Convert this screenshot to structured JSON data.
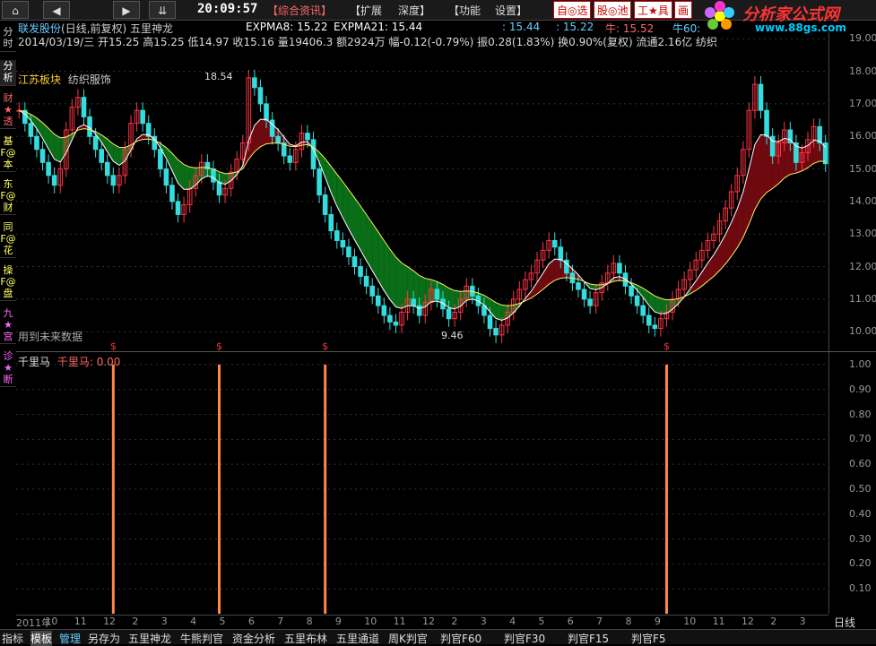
{
  "toolbar": {
    "nav_buttons": [
      "⌂",
      "◀",
      "▶",
      "⇊"
    ],
    "time": "20:09:57",
    "menus": [
      "【综合资讯】",
      "【扩展",
      "深度】",
      "【功能",
      "设置】"
    ],
    "right_buttons": [
      "自◎选",
      "股◎池",
      "工★具",
      "画"
    ],
    "logo": "分析家公式网",
    "logo_url": "www.88gs.com"
  },
  "left_tabs": [
    "分时",
    "分析",
    "财★透",
    "基F@本",
    "东F@财",
    "同F@花",
    "操F@盘",
    "九★宫",
    "诊★断"
  ],
  "header": {
    "stock": "联发股份",
    "mode": "(日线,前复权)",
    "indicator": "五里神龙",
    "expma8": "EXPMA8: 15.22",
    "expma21": "EXPMA21: 15.44",
    "r1": ": 15.44",
    "r2": ": 15.22",
    "r3": "牛: 15.52",
    "r4": "牛60:",
    "line2": "2014/03/19/三 开15.25 高15.25 低14.97 收15.16 量19406.3 额2924万 幅-0.12(-0.79%) 振0.28(1.83%) 换0.90%(复权) 流通2.16亿 纺织",
    "sector": "江苏板块",
    "industry": "纺织服饰",
    "hint": "用到未来数据",
    "hi_label": "18.54",
    "lo_label": "9.46"
  },
  "indicator_panel": {
    "name": "千里马",
    "value_label": "千里马: 0.00"
  },
  "chart_data": [
    {
      "type": "line",
      "title": "",
      "ylim": [
        9.4,
        19.2
      ],
      "yticks": [
        10,
        11,
        12,
        13,
        14,
        15,
        16,
        17,
        18,
        19
      ],
      "close": [
        16.8,
        16.4,
        16.0,
        15.6,
        15.2,
        14.8,
        14.5,
        15.0,
        16.2,
        16.9,
        17.2,
        16.6,
        16.0,
        15.6,
        15.2,
        14.8,
        14.5,
        14.8,
        15.6,
        16.4,
        16.8,
        16.4,
        16.0,
        15.6,
        15.0,
        14.5,
        14.0,
        13.6,
        13.9,
        14.4,
        14.8,
        15.2,
        15.0,
        14.6,
        14.2,
        14.4,
        14.9,
        15.3,
        15.8,
        17.8,
        17.5,
        17.0,
        16.5,
        16.0,
        15.8,
        15.4,
        15.2,
        15.6,
        16.1,
        15.9,
        15.0,
        14.2,
        13.6,
        13.1,
        12.8,
        12.6,
        12.3,
        12.0,
        11.7,
        11.4,
        11.1,
        10.8,
        10.5,
        10.3,
        10.2,
        10.6,
        11.0,
        10.8,
        10.5,
        10.9,
        11.3,
        11.0,
        10.7,
        10.4,
        10.6,
        11.0,
        11.4,
        11.1,
        10.8,
        10.5,
        10.1,
        9.9,
        10.2,
        10.6,
        11.0,
        11.3,
        11.6,
        11.8,
        12.2,
        12.5,
        12.8,
        12.6,
        12.2,
        11.8,
        11.5,
        11.3,
        11.0,
        10.8,
        11.2,
        11.5,
        11.8,
        12.1,
        11.8,
        11.4,
        11.1,
        10.8,
        10.5,
        10.2,
        10.1,
        10.4,
        10.6,
        11.0,
        11.3,
        11.6,
        11.9,
        12.2,
        12.5,
        12.8,
        13.0,
        13.4,
        13.8,
        14.3,
        14.8,
        15.6,
        16.8,
        17.6,
        16.8,
        16.0,
        15.4,
        15.8,
        16.2,
        15.8,
        15.2,
        15.5,
        15.9,
        16.3,
        15.8,
        15.16
      ],
      "indicator": "千里马",
      "signal_bars": [
        16,
        34,
        52,
        110
      ]
    },
    {
      "type": "bar",
      "title": "",
      "ylim": [
        0,
        1.05
      ],
      "yticks": [
        0.1,
        0.2,
        0.3,
        0.4,
        0.5,
        0.6,
        0.7,
        0.8,
        0.9,
        1.0
      ]
    }
  ],
  "x_axis": [
    "2011年",
    "10",
    "11",
    "12",
    "2",
    "3",
    "4",
    "5",
    "6",
    "7",
    "8",
    "9",
    "10",
    "11",
    "12",
    "2",
    "3",
    "4",
    "5",
    "6",
    "7",
    "8",
    "9",
    "10",
    "11",
    "12",
    "2",
    "3"
  ],
  "bottom_tabs": [
    "指标",
    "模板",
    "管理",
    "另存为",
    "五里神龙",
    "牛熊判官",
    "资金分析",
    "五里布林",
    "五里通道",
    "周K判官",
    "判官F60",
    "判官F30",
    "判官F15",
    "判官F5"
  ],
  "daily": "日线",
  "colors": {
    "up": "#ff3344",
    "down": "#33dddd",
    "ribbon_green": "#0a7a1a",
    "ribbon_red": "#7a0a12",
    "yellow": "#ffee66",
    "signal": "#ff8844"
  }
}
